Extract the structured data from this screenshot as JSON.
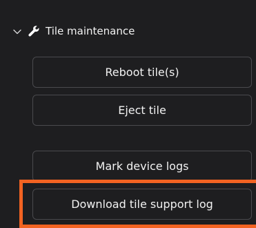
{
  "section": {
    "title": "Tile maintenance",
    "expanded": true,
    "chevron_icon": "chevron-down-icon",
    "icon": "wrench-icon"
  },
  "buttons": {
    "reboot": "Reboot tile(s)",
    "eject": "Eject tile",
    "mark_logs": "Mark device logs",
    "download_log": "Download tile support log"
  },
  "highlight_color": "#f26322"
}
